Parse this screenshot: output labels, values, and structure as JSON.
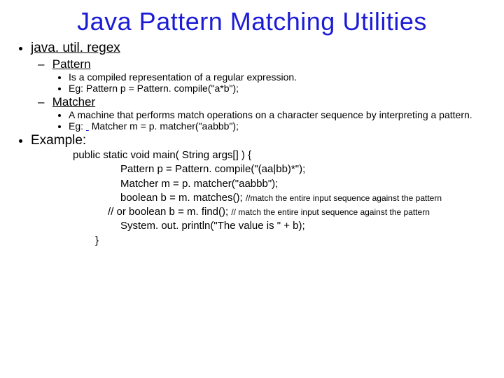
{
  "title": "Java Pattern Matching Utilities",
  "pkg": "java. util. regex",
  "pattern": {
    "name": "Pattern",
    "desc": "Is a compiled representation of a regular expression.",
    "eg": "Eg: Pattern p = Pattern. compile(\"a*b\");"
  },
  "matcher": {
    "name": "Matcher",
    "desc": "A machine that performs match operations on a character sequence by interpreting a pattern.",
    "eg_prefix": "Eg: ",
    "eg_rest": "Matcher m = p. matcher(\"aabbb\");"
  },
  "example_label": "Example:",
  "code": {
    "l1": "public static void main( String args[] ) {",
    "l2": "Pattern p = Pattern. compile(\"(aa|bb)*\");",
    "l3": "Matcher m = p. matcher(\"aabbb\");",
    "l4a": "boolean b = m. matches(); ",
    "l4b": "//match the entire input sequence against the pattern",
    "l5a": "// or boolean b = m. find(); ",
    "l5b": "// match the entire input sequence against the pattern",
    "l6": "System. out. println(\"The value is \" + b);",
    "l7": "}"
  }
}
